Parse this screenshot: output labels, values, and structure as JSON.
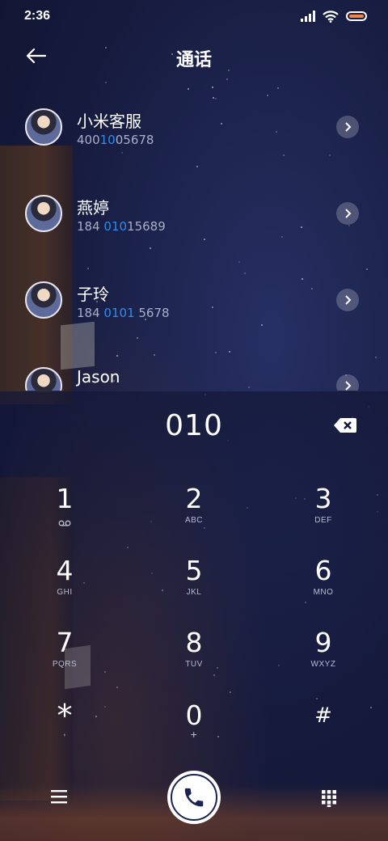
{
  "status_bar": {
    "time": "2:36",
    "icons": [
      "signal-icon",
      "wifi-icon",
      "battery-icon"
    ],
    "battery_color": "#f4843e"
  },
  "header": {
    "title": "通话",
    "back_icon": "back-arrow-icon"
  },
  "contacts": [
    {
      "name": "小米客服",
      "number_pre": "400",
      "number_hl": "10",
      "number_post": "05678"
    },
    {
      "name": "燕婷",
      "number_pre": "184 ",
      "number_hl": "010",
      "number_post": "15689"
    },
    {
      "name": "子玲",
      "number_pre": "184 ",
      "number_hl": "0101",
      "number_post": " 5678"
    },
    {
      "name": "Jason",
      "number_pre": "",
      "number_hl": "",
      "number_post": ""
    }
  ],
  "dialer": {
    "entered_number": "010",
    "keys": [
      {
        "digit": "1",
        "letters": ""
      },
      {
        "digit": "2",
        "letters": "ABC"
      },
      {
        "digit": "3",
        "letters": "DEF"
      },
      {
        "digit": "4",
        "letters": "GHI"
      },
      {
        "digit": "5",
        "letters": "JKL"
      },
      {
        "digit": "6",
        "letters": "MNO"
      },
      {
        "digit": "7",
        "letters": "PQRS"
      },
      {
        "digit": "8",
        "letters": "TUV"
      },
      {
        "digit": "9",
        "letters": "WXYZ"
      },
      {
        "digit": "*",
        "letters": ","
      },
      {
        "digit": "0",
        "letters": "+"
      },
      {
        "digit": "#",
        "letters": ""
      }
    ]
  },
  "bottom_bar": {
    "menu_icon": "menu-icon",
    "call_icon": "phone-icon",
    "keypad_icon": "keypad-icon"
  },
  "colors": {
    "highlight": "#2f8cf0",
    "background": "#15193a"
  }
}
